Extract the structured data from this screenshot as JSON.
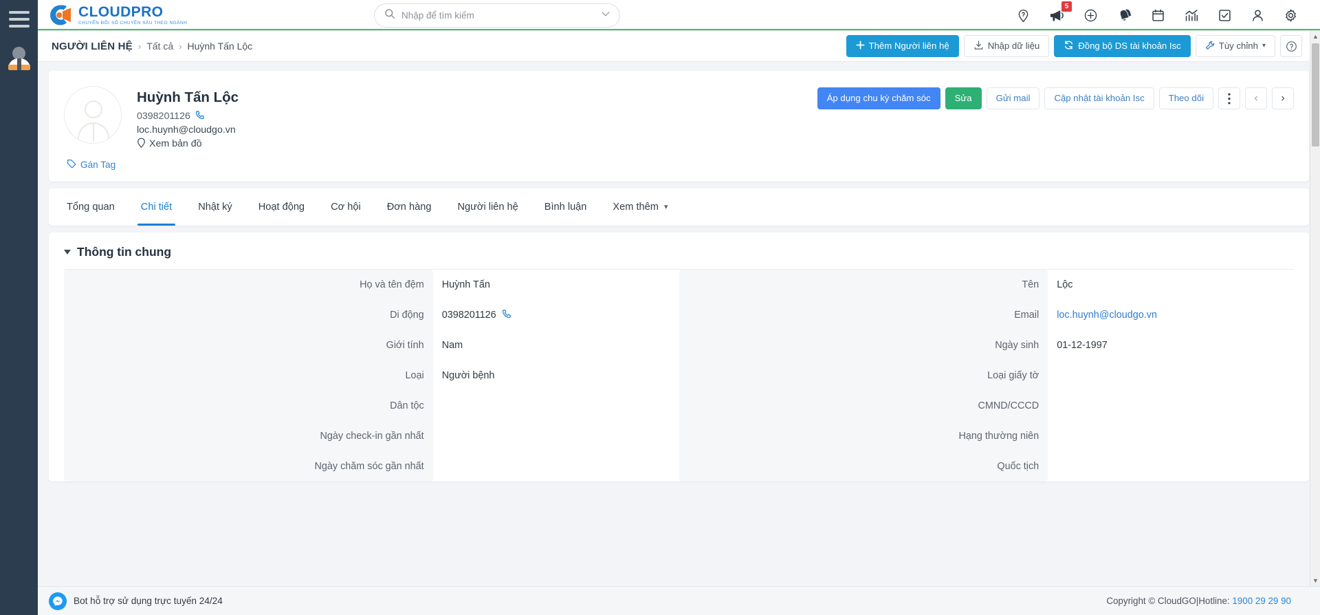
{
  "brand": {
    "name": "CLOUDPRO",
    "tagline": "CHUYỂN ĐỔI SỐ CHUYÊN SÂU THEO NGÀNH",
    "blue": "#1a73c8",
    "orange": "#ef7622"
  },
  "search": {
    "placeholder": "Nhập để tìm kiếm",
    "value": ""
  },
  "topbar_icons": [
    {
      "name": "help-location-icon",
      "label": "Trợ giúp"
    },
    {
      "name": "megaphone-icon",
      "label": "Thông báo",
      "badge": "5"
    },
    {
      "name": "plus-circle-icon",
      "label": "Thêm mới"
    },
    {
      "name": "bell-icon",
      "label": "Nhắc nhở"
    },
    {
      "name": "calendar-icon",
      "label": "Lịch"
    },
    {
      "name": "chart-icon",
      "label": "Báo cáo"
    },
    {
      "name": "checkbox-icon",
      "label": "Công việc"
    },
    {
      "name": "user-icon",
      "label": "Tài khoản"
    },
    {
      "name": "gear-icon",
      "label": "Cài đặt"
    }
  ],
  "breadcrumb": {
    "root": "NGƯỜI LIÊN HỆ",
    "separator": "›",
    "items": [
      "Tất cả",
      "Huỳnh Tấn Lộc"
    ]
  },
  "page_actions": {
    "add": "Thêm Người liên hệ",
    "import": "Nhập dữ liệu",
    "sync": "Đồng bộ DS tài khoản Isc",
    "customize": "Tùy chỉnh",
    "help": "?"
  },
  "profile": {
    "name": "Huỳnh Tấn Lộc",
    "phone": "0398201126",
    "email": "loc.huynh@cloudgo.vn",
    "map_label": "Xem bản đồ",
    "tag_label": "Gán Tag",
    "actions": {
      "apply_cycle": "Áp dụng chu kỳ chăm sóc",
      "edit": "Sửa",
      "send_mail": "Gửi mail",
      "update_account": "Cập nhật tài khoản Isc",
      "follow": "Theo dõi",
      "more": "⋮",
      "prev": "‹",
      "next": "›"
    }
  },
  "tabs": [
    {
      "label": "Tổng quan",
      "active": false
    },
    {
      "label": "Chi tiết",
      "active": true
    },
    {
      "label": "Nhật ký",
      "active": false
    },
    {
      "label": "Hoạt động",
      "active": false
    },
    {
      "label": "Cơ hội",
      "active": false
    },
    {
      "label": "Đơn hàng",
      "active": false
    },
    {
      "label": "Người liên hệ",
      "active": false
    },
    {
      "label": "Bình luận",
      "active": false
    },
    {
      "label": "Xem thêm",
      "active": false,
      "has_chevron": true
    }
  ],
  "detail": {
    "section_title": "Thông tin chung",
    "left_fields": [
      {
        "label": "Họ và tên đệm",
        "value": "Huỳnh Tấn",
        "type": "text"
      },
      {
        "label": "Di động",
        "value": "0398201126",
        "type": "phone"
      },
      {
        "label": "Giới tính",
        "value": "Nam",
        "type": "text"
      },
      {
        "label": "Loại",
        "value": "Người bệnh",
        "type": "text"
      },
      {
        "label": "Dân tộc",
        "value": "",
        "type": "text"
      },
      {
        "label": "Ngày check-in gần nhất",
        "value": "",
        "type": "text"
      },
      {
        "label": "Ngày chăm sóc gần nhất",
        "value": "",
        "type": "text"
      }
    ],
    "right_fields": [
      {
        "label": "Tên",
        "value": "Lộc",
        "type": "text"
      },
      {
        "label": "Email",
        "value": "loc.huynh@cloudgo.vn",
        "type": "link"
      },
      {
        "label": "Ngày sinh",
        "value": "01-12-1997",
        "type": "text"
      },
      {
        "label": "Loại giấy tờ",
        "value": "",
        "type": "text"
      },
      {
        "label": "CMND/CCCD",
        "value": "",
        "type": "text"
      },
      {
        "label": "Hạng thường niên",
        "value": "",
        "type": "text"
      },
      {
        "label": "Quốc tịch",
        "value": "",
        "type": "text"
      }
    ]
  },
  "footer": {
    "bot_text": "Bot hỗ trợ sử dụng trực tuyến 24/24",
    "copyright": "Copyright © CloudGO|Hotline: ",
    "hotline": "1900 29 29 90"
  }
}
